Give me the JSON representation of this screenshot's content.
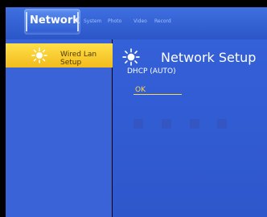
{
  "top_bar": {
    "active_tab": "Network",
    "other_tabs": [
      "System",
      "Photo",
      "Video",
      "Record"
    ]
  },
  "left_menu": {
    "items": [
      {
        "label": "Wired Lan Setup",
        "icon": "sun-icon",
        "selected": true
      }
    ]
  },
  "main": {
    "title": "Network Setup",
    "title_icon": "sun-icon",
    "mode_label": "DHCP (AUTO)",
    "button_label": "OK"
  },
  "colors": {
    "accent": "#f5c62a",
    "panel_blue": "#2f5fd6",
    "text_white": "#ffffff",
    "text_yellow": "#ffd84a"
  }
}
